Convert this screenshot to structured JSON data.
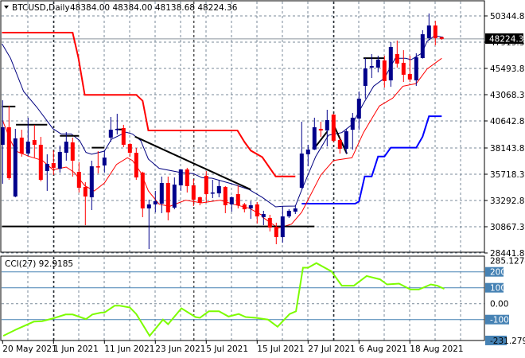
{
  "chart_data": {
    "type": "candlestick",
    "header": {
      "symbol_timeframe": "BTCUSD,Daily",
      "ohlc_text": "48384.00 48384.00 48138.68 48224.36"
    },
    "colors": {
      "bull": "#00008b",
      "bear": "#ff0000",
      "grid": "#7a8a99",
      "fast_ma": "#000080",
      "slow_ma": "#ff0000",
      "upper_channel": "#ff0000",
      "lower_channel": "#0000ff",
      "cci_line": "#7cfc00",
      "cci_levels": "#4682b4",
      "trendlines": "#000000"
    },
    "price_axis": {
      "max": 50344.8,
      "min": 28441.8,
      "ticks": [
        "50344.80",
        "47919.30",
        "45493.80",
        "43068.30",
        "40642.80",
        "38143.80",
        "35718.30",
        "33292.80",
        "30867.30",
        "28441.80"
      ],
      "current_price": 48224.36,
      "current_price_label": "48224.36"
    },
    "date_ticks": [
      {
        "bar": 1,
        "label": "20 May 2021"
      },
      {
        "bar": 9,
        "label": "1 Jun 2021"
      },
      {
        "bar": 17,
        "label": "11 Jun 2021"
      },
      {
        "bar": 25,
        "label": "23 Jun 2021"
      },
      {
        "bar": 33,
        "label": "5 Jul 2021"
      },
      {
        "bar": 41,
        "label": "15 Jul 2021"
      },
      {
        "bar": 49,
        "label": "27 Jul 2021"
      },
      {
        "bar": 57,
        "label": "6 Aug 2021"
      },
      {
        "bar": 65,
        "label": "18 Aug 2021"
      }
    ],
    "month_separators": [
      9,
      31,
      53
    ],
    "candles_ohlc": [
      [
        38440,
        42550,
        34840,
        40060
      ],
      [
        40060,
        42040,
        35200,
        35350
      ],
      [
        33660,
        39910,
        33590,
        39030
      ],
      [
        39100,
        39830,
        37340,
        37630
      ],
      [
        37630,
        40940,
        37410,
        38730
      ],
      [
        38880,
        40280,
        37260,
        38440
      ],
      [
        38440,
        39170,
        35060,
        35200
      ],
      [
        36010,
        37560,
        34180,
        36670
      ],
      [
        36750,
        37920,
        35650,
        36310
      ],
      [
        36230,
        38360,
        35870,
        37780
      ],
      [
        37700,
        39610,
        36970,
        38730
      ],
      [
        38660,
        39100,
        35500,
        36970
      ],
      [
        35940,
        36820,
        34030,
        34470
      ],
      [
        34540,
        34980,
        31010,
        33660
      ],
      [
        33590,
        36970,
        32410,
        36450
      ],
      [
        36450,
        37850,
        35790,
        36380
      ],
      [
        36530,
        37850,
        35870,
        37260
      ],
      [
        39100,
        41010,
        38730,
        39830
      ],
      [
        39830,
        41300,
        39390,
        39910
      ],
      [
        39980,
        40280,
        38220,
        38440
      ],
      [
        38510,
        38590,
        37340,
        37700
      ],
      [
        37700,
        38140,
        35200,
        35420
      ],
      [
        35870,
        35950,
        31750,
        32560
      ],
      [
        32560,
        33370,
        28810,
        32930
      ],
      [
        32930,
        34180,
        32190,
        33220
      ],
      [
        33000,
        35500,
        32120,
        34910
      ],
      [
        34910,
        35500,
        31460,
        32190
      ],
      [
        32630,
        35420,
        32480,
        34760
      ],
      [
        34690,
        36160,
        34180,
        36160
      ],
      [
        36160,
        36310,
        34030,
        34620
      ],
      [
        34690,
        35280,
        32780,
        33370
      ],
      [
        33590,
        33650,
        32850,
        33070
      ],
      [
        35570,
        36010,
        33070,
        33880
      ],
      [
        33950,
        35200,
        33510,
        34030
      ],
      [
        33950,
        35130,
        33590,
        34620
      ],
      [
        34540,
        34620,
        32120,
        32850
      ],
      [
        32930,
        33660,
        32260,
        33590
      ],
      [
        33880,
        34690,
        32560,
        32850
      ],
      [
        32930,
        33070,
        32190,
        32480
      ],
      [
        32560,
        33220,
        31600,
        32850
      ],
      [
        32930,
        33150,
        31160,
        31820
      ],
      [
        31750,
        32340,
        31010,
        32040
      ],
      [
        31680,
        31970,
        30430,
        30790
      ],
      [
        30870,
        31240,
        29250,
        29910
      ],
      [
        29910,
        32780,
        29400,
        31820
      ],
      [
        31820,
        32480,
        31680,
        32340
      ],
      [
        32260,
        32850,
        32040,
        32560
      ],
      [
        34470,
        40570,
        34400,
        37630
      ],
      [
        37560,
        38440,
        36450,
        38000
      ],
      [
        38000,
        40940,
        37950,
        40060
      ],
      [
        39910,
        40570,
        39170,
        39760
      ],
      [
        39760,
        41670,
        38290,
        40720
      ],
      [
        41230,
        41300,
        38660,
        38810
      ],
      [
        38880,
        39100,
        37630,
        38070
      ],
      [
        38070,
        39910,
        37630,
        39690
      ],
      [
        39830,
        41380,
        38000,
        40940
      ],
      [
        40860,
        43360,
        39830,
        42700
      ],
      [
        43880,
        46450,
        42700,
        45490
      ],
      [
        45570,
        46820,
        44610,
        45710
      ],
      [
        45570,
        46670,
        45130,
        46300
      ],
      [
        46230,
        46670,
        43730,
        44320
      ],
      [
        44390,
        47920,
        43800,
        47480
      ],
      [
        46820,
        48070,
        45570,
        45940
      ],
      [
        46010,
        47180,
        44240,
        44910
      ],
      [
        44980,
        46670,
        44240,
        44470
      ],
      [
        44390,
        46890,
        43880,
        46520
      ],
      [
        46450,
        49020,
        46400,
        48650
      ],
      [
        48290,
        50570,
        48140,
        49460
      ],
      [
        49460,
        49900,
        47630,
        48290
      ],
      [
        48384,
        48384,
        48138.68,
        48224.36
      ]
    ],
    "indicators": {
      "fast_ma": [
        [
          0.9,
          47770
        ],
        [
          2.25,
          46430
        ],
        [
          4.3,
          43360
        ],
        [
          6.4,
          41890
        ],
        [
          8.9,
          39930
        ],
        [
          10.2,
          39440
        ],
        [
          11.8,
          39440
        ],
        [
          13.1,
          38830
        ],
        [
          14.1,
          37730
        ],
        [
          15,
          37560
        ],
        [
          17,
          37850
        ],
        [
          18.1,
          38950
        ],
        [
          20.4,
          39610
        ],
        [
          21.4,
          39440
        ],
        [
          22.7,
          38830
        ],
        [
          23.9,
          37115
        ],
        [
          25.6,
          36260
        ],
        [
          28.9,
          35890
        ],
        [
          31,
          35770
        ],
        [
          32.3,
          35400
        ],
        [
          33.9,
          35350
        ],
        [
          37.25,
          34790
        ],
        [
          39.75,
          34300
        ],
        [
          41.8,
          33580
        ],
        [
          43.9,
          32705
        ],
        [
          45,
          32755
        ],
        [
          47,
          32780
        ],
        [
          48.1,
          34420
        ],
        [
          50.2,
          37360
        ],
        [
          52.2,
          39320
        ],
        [
          54.3,
          39560
        ],
        [
          55.9,
          40300
        ],
        [
          57.7,
          42260
        ],
        [
          59.3,
          43850
        ],
        [
          61,
          44590
        ],
        [
          62.7,
          46430
        ],
        [
          64.3,
          46430
        ],
        [
          65.2,
          46300
        ],
        [
          66.9,
          46910
        ],
        [
          67.7,
          48010
        ],
        [
          68.9,
          48510
        ],
        [
          70.2,
          48380
        ]
      ],
      "slow_ma": [
        [
          1,
          40670
        ],
        [
          2.25,
          38830
        ],
        [
          3.1,
          37850
        ],
        [
          5.2,
          37360
        ],
        [
          7.25,
          36990
        ],
        [
          8.9,
          36140
        ],
        [
          11,
          36380
        ],
        [
          12.25,
          35890
        ],
        [
          13.9,
          34670
        ],
        [
          15.4,
          34175
        ],
        [
          17,
          34910
        ],
        [
          18.9,
          36620
        ],
        [
          20.6,
          37240
        ],
        [
          21.4,
          36990
        ],
        [
          22.7,
          35890
        ],
        [
          23.9,
          34175
        ],
        [
          25.6,
          32950
        ],
        [
          27.25,
          32755
        ],
        [
          29.75,
          33320
        ],
        [
          32.25,
          33070
        ],
        [
          35.2,
          33320
        ],
        [
          37.25,
          32950
        ],
        [
          39.75,
          32580
        ],
        [
          41.8,
          31920
        ],
        [
          41.8,
          31770
        ],
        [
          44.3,
          30740
        ],
        [
          46.4,
          31110
        ],
        [
          48,
          32210
        ],
        [
          51,
          35645
        ],
        [
          53,
          36990
        ],
        [
          55.9,
          37240
        ],
        [
          57.7,
          39560
        ],
        [
          60.2,
          42015
        ],
        [
          62.3,
          42750
        ],
        [
          63.9,
          43850
        ],
        [
          66,
          44100
        ],
        [
          67.7,
          45440
        ],
        [
          70,
          46430
        ]
      ],
      "upper_channel": [
        [
          0.9,
          48800
        ],
        [
          12,
          48800
        ],
        [
          12.9,
          46500
        ],
        [
          13.9,
          43050
        ],
        [
          22,
          43050
        ],
        [
          23,
          42500
        ],
        [
          23.9,
          39760
        ],
        [
          37.9,
          39760
        ],
        [
          39,
          38700
        ],
        [
          40,
          37900
        ],
        [
          41.8,
          37300
        ],
        [
          43.9,
          35520
        ],
        [
          47,
          35520
        ]
      ],
      "lower_channel": [
        [
          48,
          33000
        ],
        [
          56.4,
          33000
        ],
        [
          57,
          33200
        ],
        [
          57.9,
          35520
        ],
        [
          59,
          35520
        ],
        [
          60,
          37360
        ],
        [
          61,
          37360
        ],
        [
          62,
          38170
        ],
        [
          66,
          38170
        ],
        [
          67,
          39195
        ],
        [
          68,
          41080
        ],
        [
          70,
          41080
        ]
      ],
      "level_segments": [
        [
          [
            0.9,
            41970
          ],
          [
            3,
            41970
          ]
        ],
        [
          [
            3.1,
            40300
          ],
          [
            8,
            40300
          ]
        ],
        [
          [
            10,
            39270
          ],
          [
            13,
            39270
          ]
        ],
        [
          [
            15,
            38170
          ],
          [
            17,
            38170
          ]
        ],
        [
          [
            18.9,
            39860
          ],
          [
            20,
            39860
          ]
        ],
        [
          [
            57.7,
            46440
          ],
          [
            61,
            46440
          ]
        ]
      ],
      "trendlines": [
        [
          [
            21.8,
            39195
          ],
          [
            40,
            34300
          ]
        ],
        [
          [
            0.9,
            30900
          ],
          [
            50,
            30900
          ]
        ],
        [
          [
            50,
            38140
          ],
          [
            52.05,
            39690
          ]
        ],
        [
          [
            53,
            40300
          ],
          [
            55.1,
            37605
          ]
        ]
      ]
    },
    "cci": {
      "label": "CCI(27) 92.9185",
      "period": 27,
      "last_value": 92.9185,
      "max": 285.1274,
      "min": -231.2793,
      "max_label": "285.1274",
      "min_label": "-231.2793",
      "levels": [
        {
          "value": 200,
          "label": "200",
          "boxed": true
        },
        {
          "value": 100,
          "label": "100",
          "boxed": true
        },
        {
          "value": 0,
          "label": "0.00",
          "boxed": false
        },
        {
          "value": -100,
          "label": "-100",
          "boxed": true
        }
      ],
      "points": [
        [
          1.1,
          -202
        ],
        [
          3.2,
          -161
        ],
        [
          5.9,
          -113
        ],
        [
          7.2,
          -110
        ],
        [
          8.8,
          -94
        ],
        [
          10.9,
          -68
        ],
        [
          12,
          -68
        ],
        [
          14.1,
          -97
        ],
        [
          15.1,
          -68
        ],
        [
          16.5,
          -56
        ],
        [
          17,
          -56
        ],
        [
          18.6,
          -13
        ],
        [
          19.4,
          -13
        ],
        [
          21,
          -24
        ],
        [
          22,
          -65
        ],
        [
          24.1,
          -202
        ],
        [
          26.2,
          -100
        ],
        [
          27,
          -129
        ],
        [
          29.1,
          -29
        ],
        [
          31.3,
          -84
        ],
        [
          32,
          -89
        ],
        [
          33.4,
          -48
        ],
        [
          35,
          -48
        ],
        [
          36.5,
          -81
        ],
        [
          38.1,
          -65
        ],
        [
          39.2,
          -84
        ],
        [
          40.8,
          -89
        ],
        [
          42.7,
          -100
        ],
        [
          44.2,
          -145
        ],
        [
          46.1,
          -65
        ],
        [
          47.1,
          -48
        ],
        [
          48.2,
          226
        ],
        [
          49,
          226
        ],
        [
          50.3,
          255
        ],
        [
          52.7,
          202
        ],
        [
          54.3,
          113
        ],
        [
          56.2,
          113
        ],
        [
          58.2,
          174
        ],
        [
          60.3,
          153
        ],
        [
          61.4,
          121
        ],
        [
          63.3,
          126
        ],
        [
          65.1,
          89
        ],
        [
          66.4,
          89
        ],
        [
          68.3,
          121
        ],
        [
          69.3,
          113
        ],
        [
          70.4,
          93
        ]
      ]
    }
  }
}
